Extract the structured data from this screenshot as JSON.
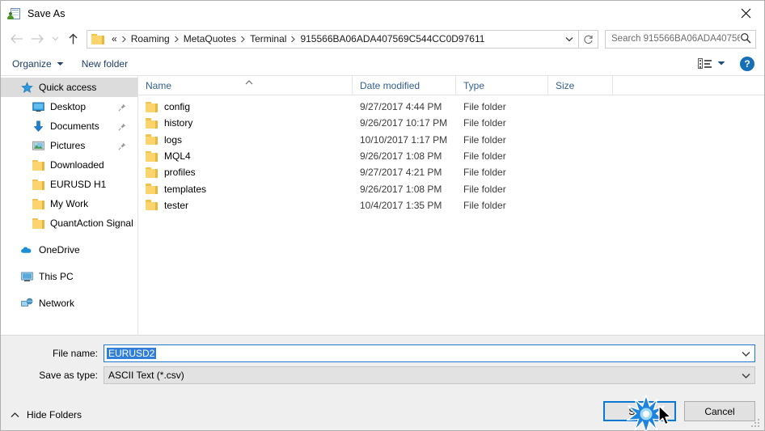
{
  "window": {
    "title": "Save As",
    "title_icon": "save-as-icon",
    "close_icon": "close-icon"
  },
  "nav": {
    "back_icon": "arrow-left-icon",
    "forward_icon": "arrow-right-icon",
    "recent_icon": "chevron-down-icon",
    "up_icon": "arrow-up-icon",
    "refresh_icon": "refresh-icon",
    "dropdown_icon": "chevron-down-icon",
    "folder_icon": "folder-icon",
    "breadcrumbs": [
      {
        "label": "«"
      },
      {
        "label": "Roaming"
      },
      {
        "label": "MetaQuotes"
      },
      {
        "label": "Terminal"
      },
      {
        "label": "915566BA06ADA407569C544CC0D97611"
      }
    ]
  },
  "search": {
    "placeholder": "Search 915566BA06ADA40756...",
    "icon": "search-icon"
  },
  "toolbar": {
    "organize_label": "Organize",
    "organize_caret_icon": "chevron-down-icon",
    "new_folder_label": "New folder",
    "view_icon": "list-view-icon",
    "view_caret_icon": "chevron-down-icon",
    "help_label": "?",
    "help_icon": "help-icon"
  },
  "sidebar": {
    "items": [
      {
        "label": "Quick access",
        "icon": "star-pin-icon",
        "selected": true,
        "level": "root",
        "pinned": false
      },
      {
        "label": "Desktop",
        "icon": "desktop-icon",
        "selected": false,
        "level": "child",
        "pinned": true
      },
      {
        "label": "Documents",
        "icon": "documents-download-icon",
        "selected": false,
        "level": "child",
        "pinned": true
      },
      {
        "label": "Pictures",
        "icon": "pictures-icon",
        "selected": false,
        "level": "child",
        "pinned": true
      },
      {
        "label": "Downloaded",
        "icon": "folder-icon",
        "selected": false,
        "level": "child",
        "pinned": false
      },
      {
        "label": "EURUSD H1",
        "icon": "folder-icon",
        "selected": false,
        "level": "child",
        "pinned": false
      },
      {
        "label": "My Work",
        "icon": "folder-icon",
        "selected": false,
        "level": "child",
        "pinned": false
      },
      {
        "label": "QuantAction Signal",
        "icon": "folder-icon",
        "selected": false,
        "level": "child",
        "pinned": false
      },
      {
        "label": "OneDrive",
        "icon": "onedrive-cloud-icon",
        "selected": false,
        "level": "root",
        "pinned": false,
        "gap_before": true
      },
      {
        "label": "This PC",
        "icon": "this-pc-icon",
        "selected": false,
        "level": "root",
        "pinned": false,
        "gap_before": true
      },
      {
        "label": "Network",
        "icon": "network-icon",
        "selected": false,
        "level": "root",
        "pinned": false,
        "gap_before": true
      }
    ]
  },
  "file_list": {
    "sort_indicator_icon": "sort-ascending-icon",
    "columns": [
      {
        "label": "Name"
      },
      {
        "label": "Date modified"
      },
      {
        "label": "Type"
      },
      {
        "label": "Size"
      }
    ],
    "rows": [
      {
        "name": "config",
        "date": "9/27/2017 4:44 PM",
        "type": "File folder",
        "size": "",
        "icon": "folder-icon"
      },
      {
        "name": "history",
        "date": "9/26/2017 10:17 PM",
        "type": "File folder",
        "size": "",
        "icon": "folder-icon"
      },
      {
        "name": "logs",
        "date": "10/10/2017 1:17 PM",
        "type": "File folder",
        "size": "",
        "icon": "folder-icon"
      },
      {
        "name": "MQL4",
        "date": "9/26/2017 1:08 PM",
        "type": "File folder",
        "size": "",
        "icon": "folder-icon"
      },
      {
        "name": "profiles",
        "date": "9/27/2017 4:21 PM",
        "type": "File folder",
        "size": "",
        "icon": "folder-icon"
      },
      {
        "name": "templates",
        "date": "9/26/2017 1:08 PM",
        "type": "File folder",
        "size": "",
        "icon": "folder-icon"
      },
      {
        "name": "tester",
        "date": "10/4/2017 1:35 PM",
        "type": "File folder",
        "size": "",
        "icon": "folder-icon"
      }
    ]
  },
  "form": {
    "filename_label": "File name:",
    "filename_value": "EURUSD2",
    "filename_caret_icon": "chevron-down-icon",
    "filetype_label": "Save as type:",
    "filetype_value": "ASCII Text (*.csv)",
    "filetype_caret_icon": "chevron-down-icon"
  },
  "actions": {
    "save_label": "Save",
    "cancel_label": "Cancel",
    "hide_folders_label": "Hide Folders",
    "hide_folders_caret_icon": "chevron-up-icon",
    "resize_grip_icon": "resize-grip-icon",
    "cursor_icon": "mouse-cursor-icon",
    "click_burst_icon": "click-burst-icon"
  },
  "colors": {
    "accent": "#0b78d4",
    "selection": "#2f7ed8",
    "header_text": "#33618f",
    "folder": "#fbd46d",
    "footer_bg": "#efefef"
  }
}
